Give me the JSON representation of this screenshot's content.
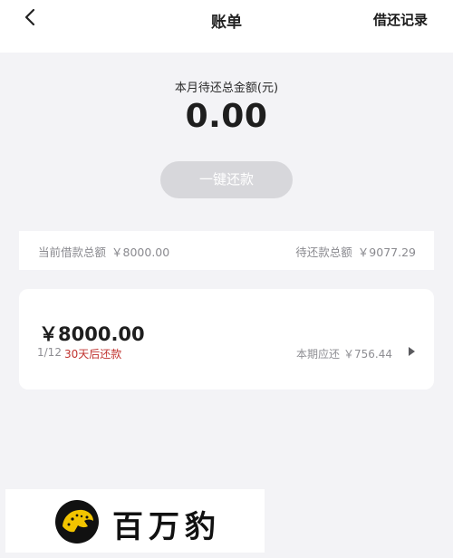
{
  "header": {
    "title": "账单",
    "action_label": "借还记录"
  },
  "summary": {
    "label": "本月待还总金额(元)",
    "amount": "0.00",
    "repay_button_label": "一键还款"
  },
  "totals": {
    "borrowed_label": "当前借款总额",
    "borrowed_value": "￥8000.00",
    "pending_label": "待还款总额",
    "pending_value": "￥9077.29"
  },
  "loan": {
    "amount": "￥8000.00",
    "period": "1/12",
    "due_text": "30天后还款",
    "current_label": "本期应还",
    "current_value": "￥756.44"
  },
  "brand": {
    "name": "百万豹",
    "accent_color": "#f2c400"
  },
  "colors": {
    "due_red": "#c0322e",
    "button_disabled": "#d7d7db",
    "background": "#f3f3f6"
  }
}
